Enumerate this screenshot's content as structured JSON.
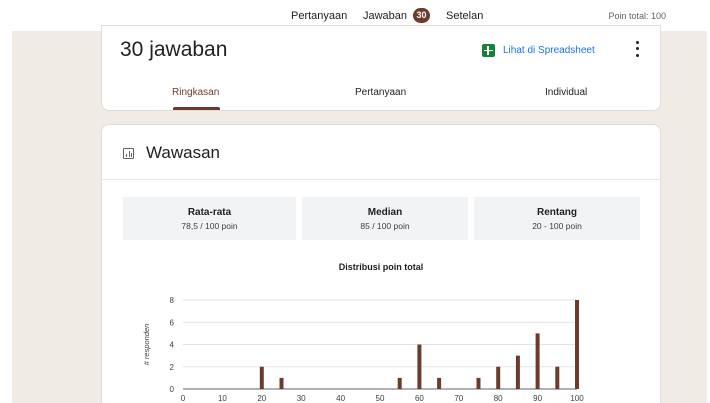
{
  "topnav": {
    "questions": "Pertanyaan",
    "responses": "Jawaban",
    "response_badge": "30",
    "settings": "Setelan",
    "total_points": "Poin total: 100"
  },
  "summary": {
    "response_count": "30 jawaban",
    "sheet_link": "Lihat di Spreadsheet",
    "tabs": [
      "Ringkasan",
      "Pertanyaan",
      "Individual"
    ]
  },
  "insights": {
    "title": "Wawasan",
    "stats": [
      {
        "label": "Rata-rata",
        "value": "78,5 / 100 poin"
      },
      {
        "label": "Median",
        "value": "85 / 100 poin"
      },
      {
        "label": "Rentang",
        "value": "20 - 100 poin"
      }
    ]
  },
  "colors": {
    "accent": "#6d3b2c",
    "background": "#f1ebe6",
    "link": "#1a73e8",
    "sheets_green": "#188038"
  },
  "chart_data": {
    "type": "bar",
    "title": "Distribusi poin total",
    "ylabel": "# responden",
    "xlabel": "",
    "xlim": [
      0,
      100
    ],
    "ylim": [
      0,
      8
    ],
    "x_ticks": [
      0,
      10,
      20,
      30,
      40,
      50,
      60,
      70,
      80,
      90,
      100
    ],
    "y_ticks": [
      0,
      2,
      4,
      6,
      8
    ],
    "grid": true,
    "x": [
      20,
      25,
      55,
      60,
      65,
      75,
      80,
      85,
      90,
      95,
      100
    ],
    "values": [
      2,
      1,
      1,
      4,
      1,
      1,
      2,
      3,
      5,
      2,
      8
    ]
  }
}
